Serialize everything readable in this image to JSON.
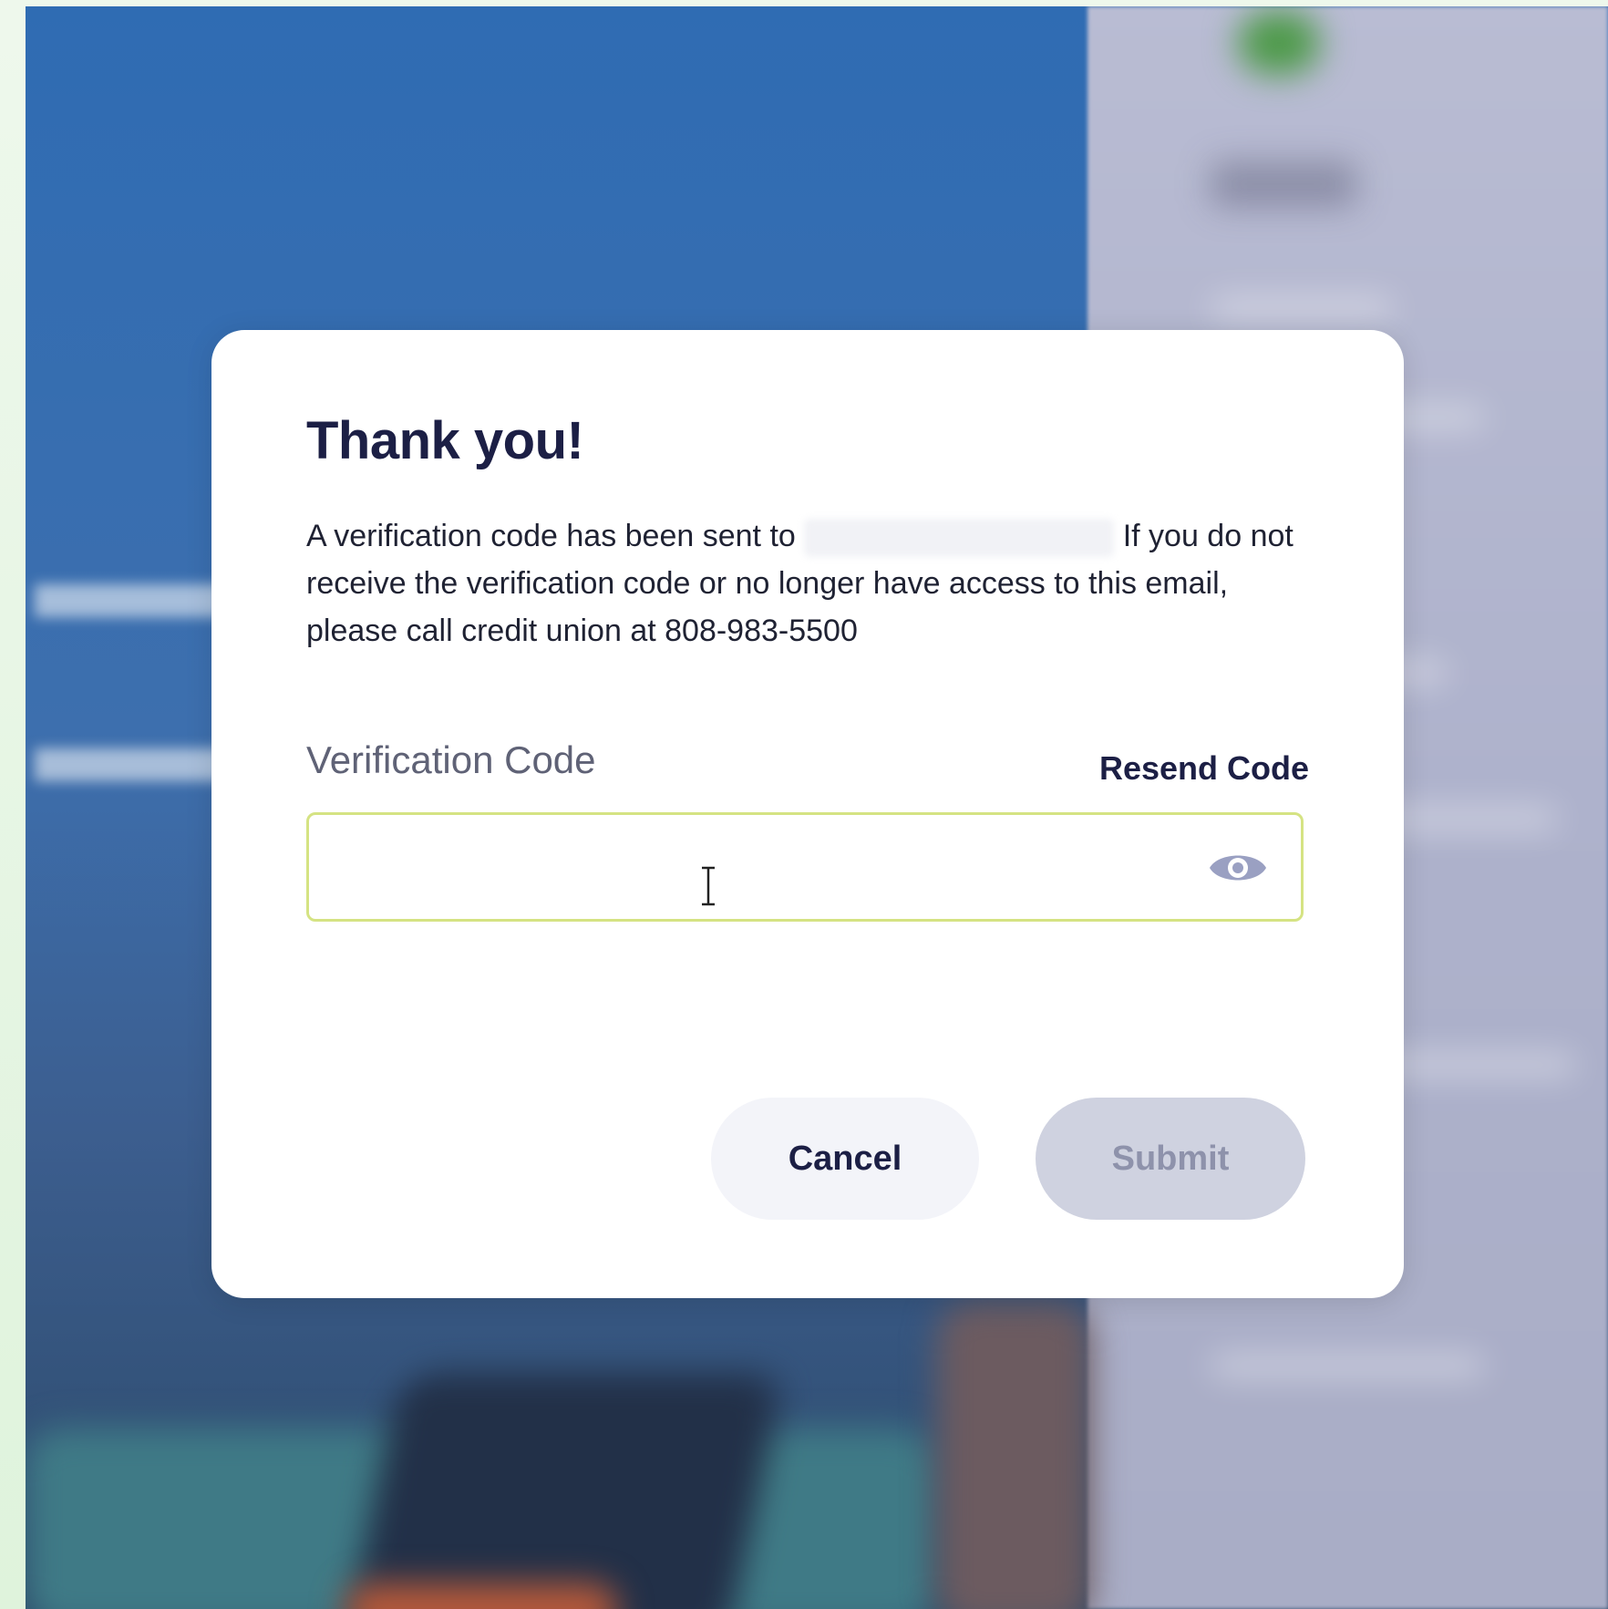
{
  "dialog": {
    "title": "Thank you!",
    "message_part1": "A verification code has been sent to",
    "message_part2": "If you do not receive the verification code or no longer have access to this email, please call credit union at 808-983-5500",
    "code_label": "Verification Code",
    "resend_label": "Resend Code",
    "code_value": "",
    "cancel_label": "Cancel",
    "submit_label": "Submit",
    "submit_enabled": false
  },
  "icons": {
    "visibility_toggle": "eye-icon",
    "text_cursor": "text-cursor-icon"
  },
  "colors": {
    "title": "#1c1f45",
    "input_border": "#d5e383",
    "submit_disabled_bg": "#cfd2e0",
    "backdrop_blue": "#2f6cb3"
  }
}
